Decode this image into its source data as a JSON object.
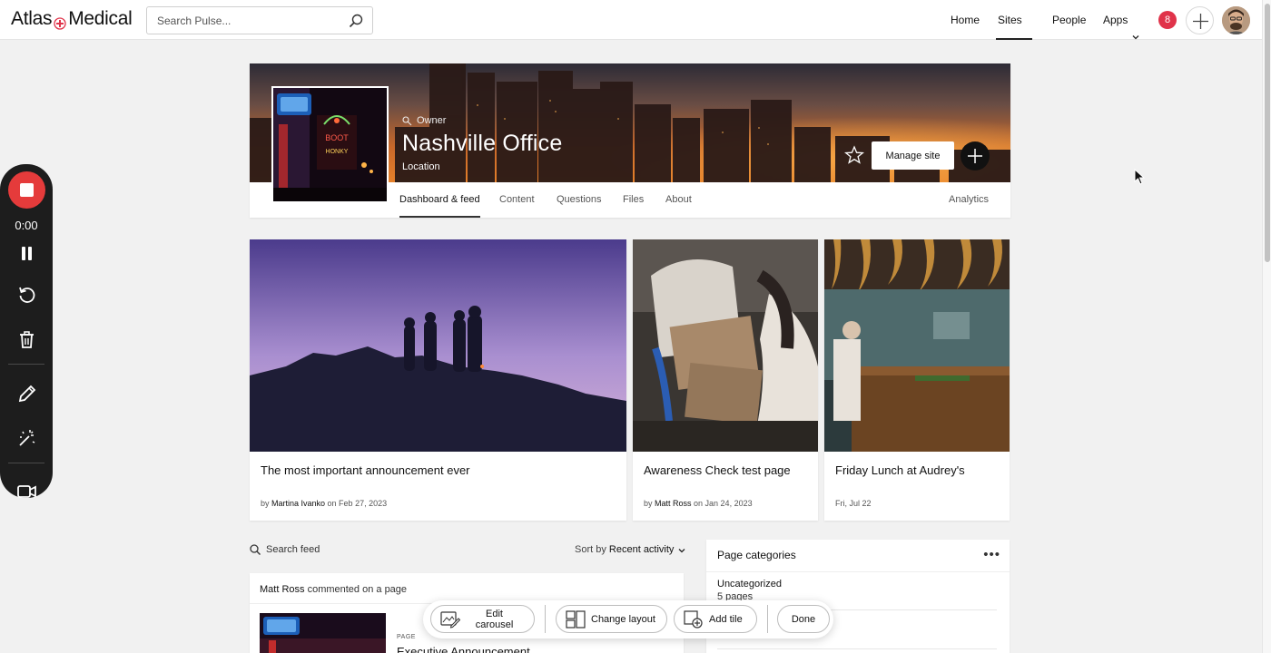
{
  "app": {
    "logo": {
      "left": "Atlas",
      "right": "Medical"
    },
    "search_placeholder": "Search Pulse...",
    "nav": [
      {
        "label": "Home",
        "dropdown": false,
        "active": false
      },
      {
        "label": "Sites",
        "dropdown": true,
        "active": true
      },
      {
        "label": "People",
        "dropdown": false,
        "active": false
      },
      {
        "label": "Apps",
        "dropdown": true,
        "active": false
      }
    ],
    "notification_count": "8",
    "accent": "#e0334a"
  },
  "site": {
    "owner_label": "Owner",
    "title": "Nashville Office",
    "location": "Location",
    "manage_label": "Manage site",
    "tabs": [
      "Dashboard & feed",
      "Content",
      "Questions",
      "Files",
      "About"
    ],
    "active_tab": "Dashboard & feed",
    "analytics_label": "Analytics"
  },
  "carousel": [
    {
      "title": "The most important announcement ever",
      "by": "by ",
      "author": "Martina Ivanko",
      "on": " on Feb 27, 2023"
    },
    {
      "title": "Awareness Check test page",
      "by": "by ",
      "author": "Matt Ross",
      "on": " on Jan 24, 2023"
    },
    {
      "title": "Friday Lunch at Audrey's",
      "date": "Fri, Jul 22"
    }
  ],
  "feed": {
    "search_label": "Search feed",
    "sort_prefix": "Sort by ",
    "sort_value": "Recent activity",
    "item": {
      "actor": "Matt Ross",
      "action": " commented on a page",
      "tag": "PAGE",
      "title": "Executive Announcement"
    }
  },
  "categories": {
    "title": "Page categories",
    "more": "•••",
    "items": [
      {
        "name": "Uncategorized",
        "count": "5 pages"
      }
    ]
  },
  "editbar": {
    "edit_carousel": "Edit carousel",
    "change_layout": "Change layout",
    "add_tile": "Add tile",
    "done": "Done"
  },
  "recorder": {
    "time": "0:00",
    "stop_color": "#e53b3b"
  }
}
